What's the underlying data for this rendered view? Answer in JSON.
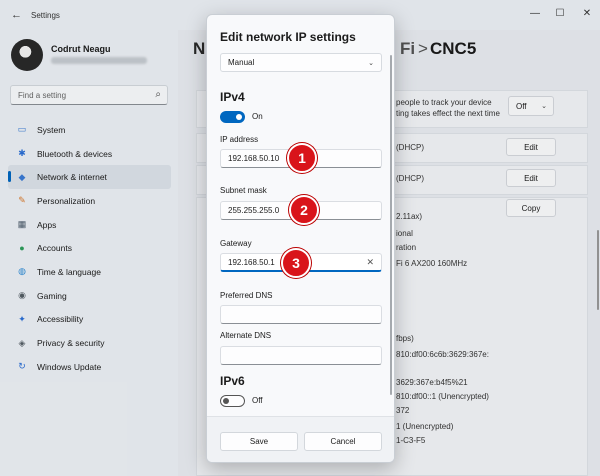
{
  "window": {
    "title": "Settings",
    "back_icon": "back-arrow-icon",
    "minimize": "—",
    "maximize": "☐",
    "close": "✕"
  },
  "user": {
    "name": "Codrut Neagu"
  },
  "search": {
    "placeholder": "Find a setting"
  },
  "sidebar": {
    "items": [
      {
        "label": "System",
        "icon": "monitor-icon",
        "glyph": "▭",
        "color": "#3a7bd5"
      },
      {
        "label": "Bluetooth & devices",
        "icon": "bluetooth-icon",
        "glyph": "✱",
        "color": "#2b6fd6"
      },
      {
        "label": "Network & internet",
        "icon": "wifi-icon",
        "glyph": "◆",
        "color": "#3a7bd5",
        "active": true
      },
      {
        "label": "Personalization",
        "icon": "brush-icon",
        "glyph": "✎",
        "color": "#d9792b"
      },
      {
        "label": "Apps",
        "icon": "apps-icon",
        "glyph": "▦",
        "color": "#4a5a6a"
      },
      {
        "label": "Accounts",
        "icon": "person-icon",
        "glyph": "●",
        "color": "#2e9e5b"
      },
      {
        "label": "Time & language",
        "icon": "globe-icon",
        "glyph": "◍",
        "color": "#2b8ad6"
      },
      {
        "label": "Gaming",
        "icon": "gamepad-icon",
        "glyph": "◉",
        "color": "#555e66"
      },
      {
        "label": "Accessibility",
        "icon": "accessibility-icon",
        "glyph": "✦",
        "color": "#2b6fd6"
      },
      {
        "label": "Privacy & security",
        "icon": "shield-icon",
        "glyph": "◈",
        "color": "#555e66"
      },
      {
        "label": "Windows Update",
        "icon": "update-icon",
        "glyph": "↻",
        "color": "#2b6fd6"
      }
    ]
  },
  "content": {
    "breadcrumb_prefix": "N",
    "breadcrumb_suffix": "Fi",
    "breadcrumb_sep": ">",
    "breadcrumb_current": "CNC5",
    "metered_text_1": "people to track your device",
    "metered_text_2": "ting takes effect the next time",
    "metered_value": "Off",
    "dhcp_1": "(DHCP)",
    "dhcp_2": "(DHCP)",
    "edit_1": "Edit",
    "edit_2": "Edit",
    "copy": "Copy",
    "props": [
      "2.11ax)",
      "ional",
      "ration",
      "Fi 6 AX200 160MHz",
      "fbps)",
      "810:df00:6c6b:3629:367e:",
      "3629:367e:b4f5%21",
      "810:df00::1 (Unencrypted)",
      "372",
      "1 (Unencrypted)",
      "1-C3-F5"
    ]
  },
  "dialog": {
    "title": "Edit network IP settings",
    "mode": "Manual",
    "ipv4_title": "IPv4",
    "ipv4_toggle": "On",
    "ip_label": "IP address",
    "ip_value": "192.168.50.10",
    "subnet_label": "Subnet mask",
    "subnet_value": "255.255.255.0",
    "gateway_label": "Gateway",
    "gateway_value": "192.168.50.1",
    "pref_dns_label": "Preferred DNS",
    "pref_dns_value": "",
    "alt_dns_label": "Alternate DNS",
    "alt_dns_value": "",
    "ipv6_title": "IPv6",
    "ipv6_toggle": "Off",
    "save": "Save",
    "cancel": "Cancel"
  },
  "markers": [
    "1",
    "2",
    "3"
  ],
  "colors": {
    "accent": "#0067c0",
    "marker": "#d9141a"
  }
}
